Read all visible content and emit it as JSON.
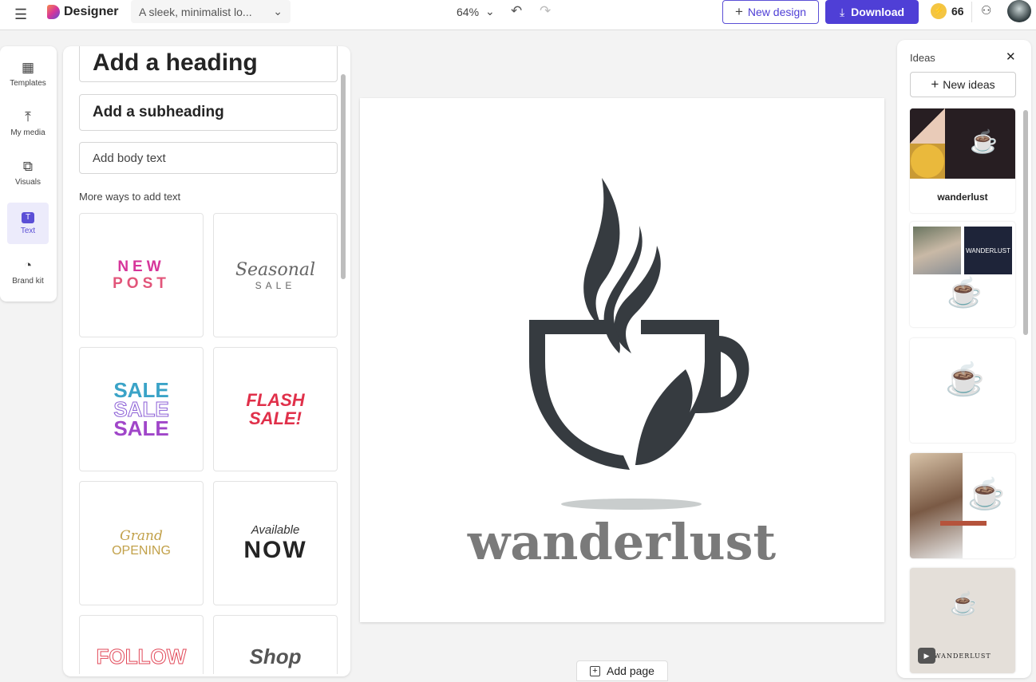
{
  "header": {
    "app_name": "Designer",
    "doc_title": "A sleek, minimalist lo...",
    "zoom": "64%",
    "new_design": "New design",
    "download": "Download",
    "credits": "66",
    "accent": "#4f3fd6"
  },
  "rail": [
    {
      "label": "Templates",
      "icon": "templates-icon"
    },
    {
      "label": "My media",
      "icon": "upload-icon"
    },
    {
      "label": "Visuals",
      "icon": "visuals-icon"
    },
    {
      "label": "Text",
      "icon": "text-icon",
      "active": true
    },
    {
      "label": "Brand kit",
      "icon": "palette-icon"
    }
  ],
  "text_panel": {
    "heading": "Add a heading",
    "subheading": "Add a subheading",
    "body": "Add body text",
    "more_label": "More ways to add text",
    "styles": [
      {
        "l1": "NEW",
        "l2": "POST"
      },
      {
        "l1": "Seasonal",
        "l2": "SALE"
      },
      {
        "l1": "SALE",
        "l2": "SALE",
        "l3": "SALE"
      },
      {
        "l1": "FLASH",
        "l2": "SALE!"
      },
      {
        "l1": "Grand",
        "l2": "OPENING"
      },
      {
        "l1": "Available",
        "l2": "NOW"
      },
      {
        "l1": "FOLLOW"
      },
      {
        "l1": "Shop"
      }
    ]
  },
  "canvas": {
    "wordmark": "wanderlust",
    "logo_color": "#363b40"
  },
  "add_page": "Add page",
  "ideas": {
    "title": "Ideas",
    "new_ideas": "New ideas",
    "items": [
      {
        "caption": "wanderlust"
      },
      {
        "caption": "WANDERLUST"
      },
      {
        "caption": ""
      },
      {
        "caption": ""
      },
      {
        "caption": "WANDERLUST"
      }
    ]
  }
}
